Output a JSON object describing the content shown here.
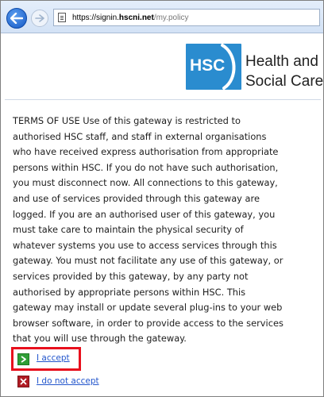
{
  "browser": {
    "url_domain_prefix": "https://signin.",
    "url_domain": "hscni.net",
    "url_path": "/my.policy"
  },
  "header": {
    "logo_text": "HSC",
    "org_name_line1": "Health and",
    "org_name_line2": "Social Care"
  },
  "terms": {
    "lines": [
      "TERMS OF USE Use of this gateway is restricted to",
      "authorised HSC staff, and staff in external organisations",
      "who have received express authorisation from appropriate",
      "persons within HSC. If you do not have such authorisation,",
      "you must disconnect now. All connections to this gateway,",
      "and use of services provided through this gateway are",
      "logged. If you are an authorised user of this gateway, you",
      "must take care to maintain the physical security of",
      "whatever systems you use to access services through this",
      "gateway. You must not facilitate any use of this gateway, or",
      "services provided by this gateway, by any party not",
      "authorised by appropriate persons within HSC. This",
      "gateway may install or update several plug-ins to your web",
      "browser software, in order to provide access to the services",
      "that you will use through the gateway."
    ]
  },
  "actions": {
    "accept_label": "I accept",
    "decline_label": "I do not accept",
    "accept_color": "#2f9e36",
    "decline_color": "#b01c24",
    "highlight_color": "#e8101d"
  },
  "icons": {
    "back": "back-arrow-icon",
    "forward": "forward-arrow-icon",
    "page": "page-icon",
    "accept": "chevron-right-icon",
    "decline": "x-icon"
  }
}
